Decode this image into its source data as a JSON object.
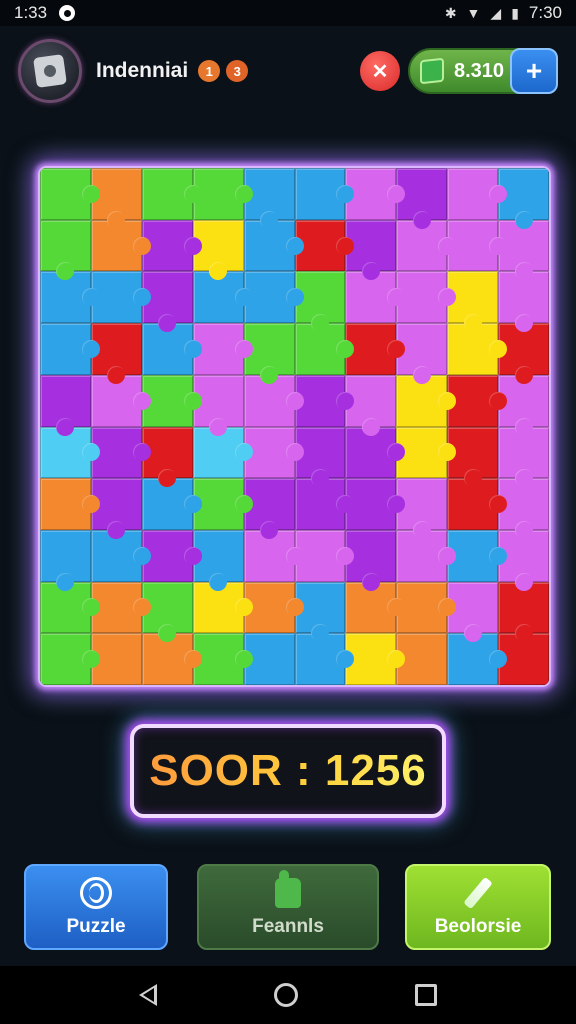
{
  "status_bar": {
    "time_left": "1:33",
    "time_right": "7:30",
    "icons": [
      "notification-dot-icon",
      "bluetooth-icon",
      "wifi-icon",
      "signal-icon",
      "battery-icon"
    ]
  },
  "header": {
    "player_name": "Indenniai",
    "badge_1": "1",
    "badge_2": "3",
    "alert_icon": "x-icon",
    "coins": "8.310",
    "add_icon": "plus-icon"
  },
  "board": {
    "rows": 10,
    "cols": 10,
    "palette": {
      "G": "#55d938",
      "O": "#f3882f",
      "B": "#2ea3e8",
      "P": "#a62fe0",
      "M": "#d865ee",
      "Y": "#fce112",
      "R": "#de1c1f",
      "C": "#4fcdf2",
      "K": "#8c2bd6"
    },
    "tiles": [
      "GOGGBBMPMB",
      "GOPYBRPMMM",
      "BBPBBGMMYM",
      "BRBMGGRMYR",
      "PMGMMPMYRM",
      "CPRCMPPYRM",
      "OPBGPPPMRM",
      "BBPBMMPMBM",
      "GOGYOBOOMR",
      "GOOGBBYOBR"
    ]
  },
  "score": {
    "label": "SOOR : 1256"
  },
  "buttons": {
    "puzzle": "Puzzle",
    "feannls": "Feannls",
    "beolorsie": "Beolorsie"
  }
}
